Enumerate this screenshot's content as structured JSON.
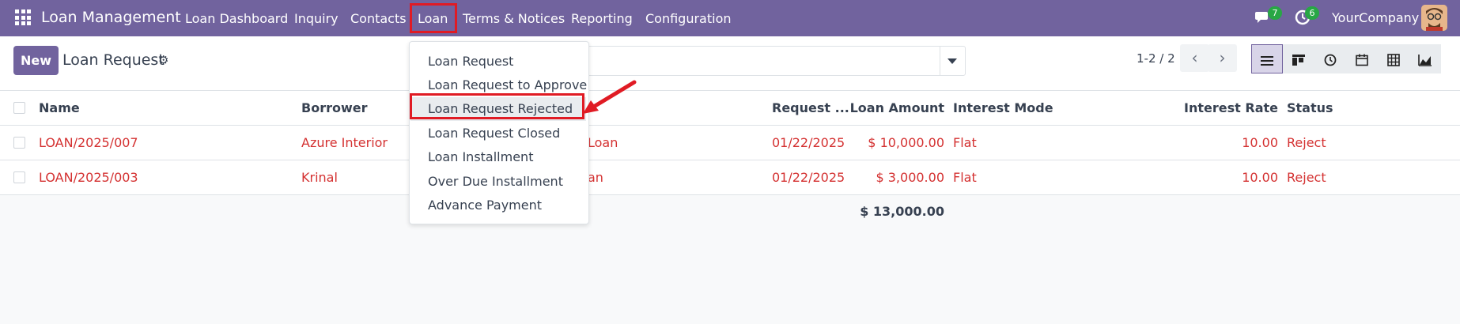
{
  "app": {
    "name": "Loan Management"
  },
  "navbar": {
    "menus": [
      "Loan Dashboard",
      "Inquiry",
      "Contacts",
      "Loan",
      "Terms & Notices",
      "Reporting",
      "Configuration"
    ],
    "messages_count": "7",
    "activities_count": "6",
    "company": "YourCompany"
  },
  "control_panel": {
    "new_label": "New",
    "title": "Loan Request",
    "pager": "1-2 / 2",
    "views": [
      "list-icon",
      "kanban-icon",
      "activity-icon",
      "calendar-icon",
      "pivot-icon",
      "graph-icon"
    ]
  },
  "dropdown": {
    "items": [
      "Loan Request",
      "Loan Request to Approve",
      "Loan Request Rejected",
      "Loan Request Closed",
      "Loan Installment",
      "Over Due Installment",
      "Advance Payment"
    ],
    "highlighted": "Loan Request Rejected"
  },
  "table": {
    "columns": [
      "Name",
      "Borrower",
      "Request ...",
      "Loan Amount",
      "Interest Mode",
      "Interest Rate",
      "Status"
    ],
    "rows": [
      {
        "name": "LOAN/2025/007",
        "borrower": "Azure Interior",
        "loan_type_partial": "Loan",
        "request_date": "01/22/2025",
        "amount": "$ 10,000.00",
        "interest_mode": "Flat",
        "interest_rate": "10.00",
        "status": "Reject"
      },
      {
        "name": "LOAN/2025/003",
        "borrower": "Krinal",
        "loan_type_partial": "an",
        "request_date": "01/22/2025",
        "amount": "$ 3,000.00",
        "interest_mode": "Flat",
        "interest_rate": "10.00",
        "status": "Reject"
      }
    ],
    "total_amount": "$ 13,000.00"
  },
  "colors": {
    "navbar": "#71639e",
    "highlight": "#e01b24",
    "row_text": "#d43131"
  }
}
